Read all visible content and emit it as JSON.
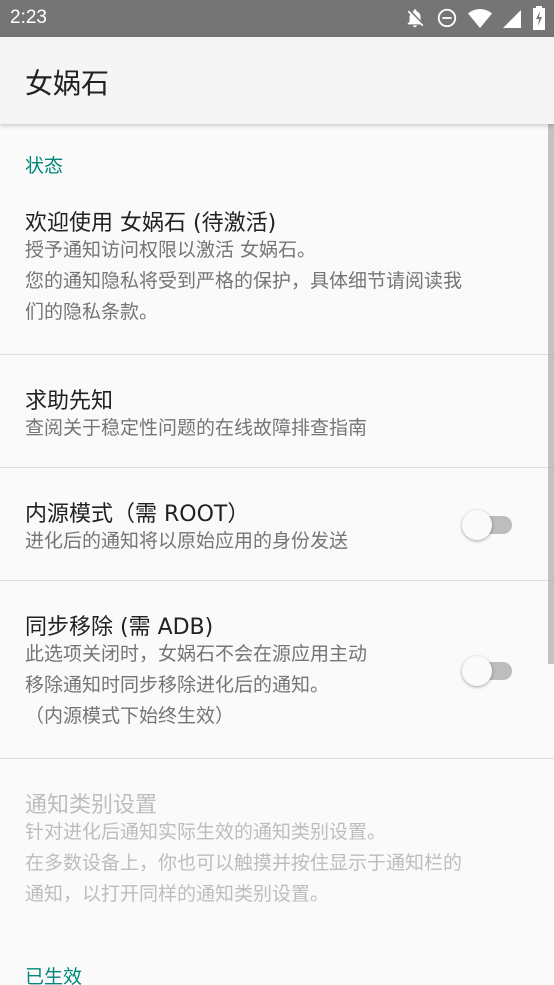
{
  "status_bar": {
    "time": "2:23",
    "icons": [
      "notifications-off-icon",
      "do-not-disturb-icon",
      "wifi-icon",
      "cellular-signal-icon",
      "battery-charging-icon"
    ]
  },
  "app_bar": {
    "title": "女娲石"
  },
  "sections": {
    "status": {
      "header": "状态",
      "welcome": {
        "title": "欢迎使用 女娲石 (待激活)",
        "summary_lines": [
          "授予通知访问权限以激活 女娲石。",
          "您的通知隐私将受到严格的保护，具体细节请阅读我",
          "们的隐私条款。"
        ]
      },
      "help": {
        "title": "求助先知",
        "summary": "查阅关于稳定性问题的在线故障排查指南"
      },
      "inner_source": {
        "title": "内源模式（需 ROOT）",
        "summary": "进化后的通知将以原始应用的身份发送",
        "enabled": false
      },
      "sync_remove": {
        "title": "同步移除 (需 ADB)",
        "summary_lines": [
          "此选项关闭时，女娲石不会在源应用主动",
          "移除通知时同步移除进化后的通知。",
          "（内源模式下始终生效）"
        ],
        "enabled": false
      },
      "channel_settings": {
        "title": "通知类别设置",
        "summary_lines": [
          "针对进化后通知实际生效的通知类别设置。",
          "在多数设备上，你也可以触摸并按住显示于通知栏的",
          "通知，以打开同样的通知类别设置。"
        ],
        "disabled": true
      }
    },
    "active": {
      "header": "已生效"
    }
  },
  "colors": {
    "accent": "#00897b",
    "status_bar": "#757575",
    "app_bar": "#f5f5f5",
    "background": "#fafafa"
  }
}
